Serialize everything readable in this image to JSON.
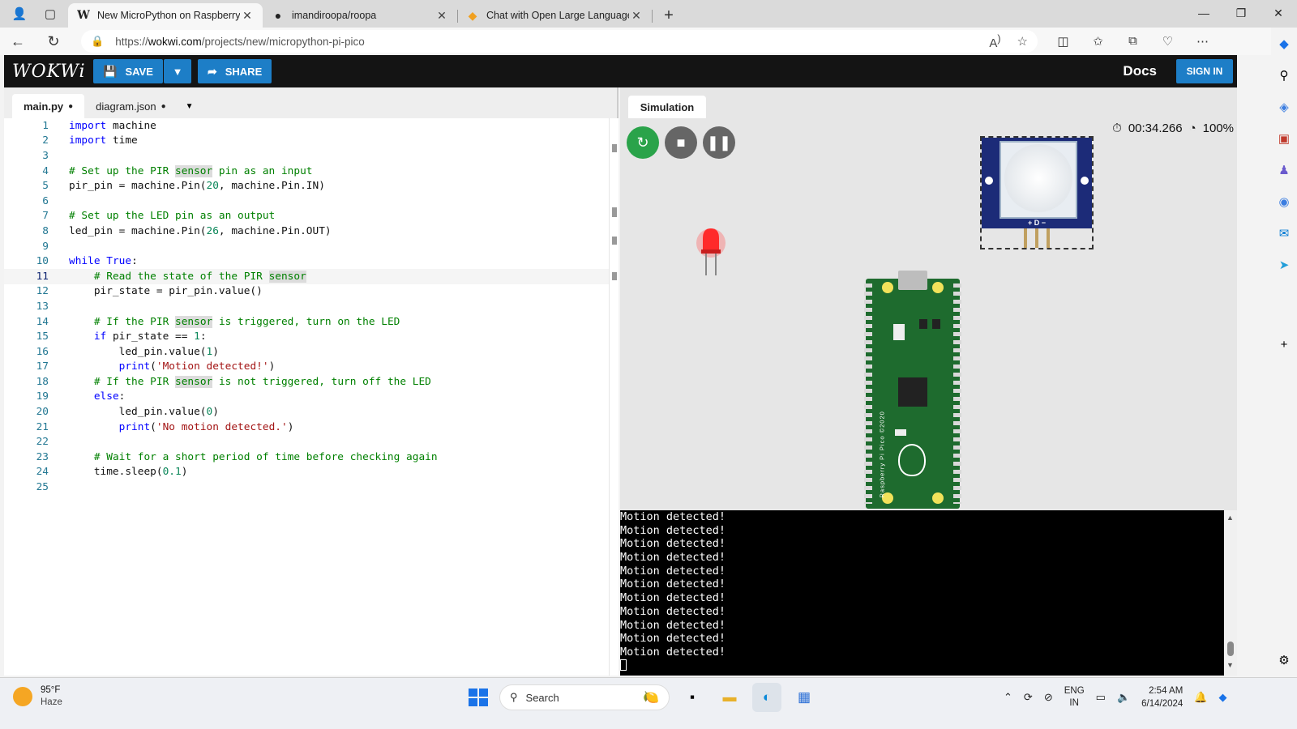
{
  "browser": {
    "tabs": [
      {
        "favicon": "W",
        "title": "New MicroPython on Raspberry Pi",
        "active": true
      },
      {
        "favicon": "github-icon",
        "title": "imandiroopa/roopa",
        "active": false
      },
      {
        "favicon": "chat-icon",
        "title": "Chat with Open Large Language",
        "active": false
      }
    ],
    "url_prefix": "https://",
    "url_host": "wokwi.com",
    "url_path": "/projects/new/micropython-pi-pico"
  },
  "wokwi": {
    "logo": "WOKWi",
    "save_label": "SAVE",
    "share_label": "SHARE",
    "docs_label": "Docs",
    "signin_label": "SIGN IN"
  },
  "editor": {
    "tabs": [
      {
        "label": "main.py",
        "modified": true
      },
      {
        "label": "diagram.json",
        "modified": true
      }
    ],
    "current_line": 11,
    "lines": [
      "import machine",
      "import time",
      "",
      "# Set up the PIR sensor pin as an input",
      "pir_pin = machine.Pin(20, machine.Pin.IN)",
      "",
      "# Set up the LED pin as an output",
      "led_pin = machine.Pin(26, machine.Pin.OUT)",
      "",
      "while True:",
      "    # Read the state of the PIR sensor",
      "    pir_state = pir_pin.value()",
      "",
      "    # If the PIR sensor is triggered, turn on the LED",
      "    if pir_state == 1:",
      "        led_pin.value(1)",
      "        print('Motion detected!')",
      "    # If the PIR sensor is not triggered, turn off the LED",
      "    else:",
      "        led_pin.value(0)",
      "        print('No motion detected.')",
      "",
      "    # Wait for a short period of time before checking again",
      "    time.sleep(0.1)",
      ""
    ]
  },
  "simulation": {
    "tab_label": "Simulation",
    "timer": "00:34.266",
    "speed": "100%",
    "board_label": "Raspberry Pi Pico ©2020",
    "pir_pins": "+ D −",
    "led_color": "#ff2a2a"
  },
  "serial": {
    "lines": [
      "Motion detected!",
      "Motion detected!",
      "Motion detected!",
      "Motion detected!",
      "Motion detected!",
      "Motion detected!",
      "Motion detected!",
      "Motion detected!",
      "Motion detected!",
      "Motion detected!",
      "Motion detected!"
    ]
  },
  "taskbar": {
    "temperature": "95°F",
    "condition": "Haze",
    "search_placeholder": "Search",
    "lang_top": "ENG",
    "lang_bottom": "IN",
    "time": "2:54 AM",
    "date": "6/14/2024"
  }
}
